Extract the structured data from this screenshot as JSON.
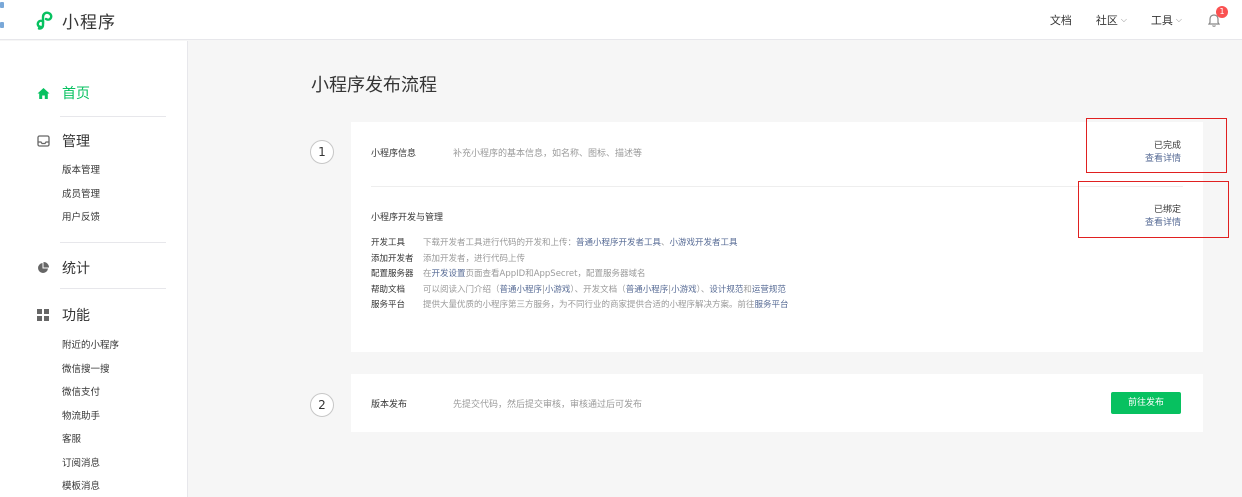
{
  "header": {
    "logo_text": "小程序",
    "nav": [
      {
        "label": "文档",
        "dropdown": false
      },
      {
        "label": "社区",
        "dropdown": true
      },
      {
        "label": "工具",
        "dropdown": true
      }
    ],
    "notification_count": "1",
    "accent_color": "#07c160",
    "link_color": "#576b95"
  },
  "sidebar": {
    "home": {
      "label": "首页",
      "icon": "home-icon"
    },
    "manage": {
      "label": "管理",
      "icon": "inbox-icon",
      "items": [
        "版本管理",
        "成员管理",
        "用户反馈"
      ]
    },
    "stats": {
      "label": "统计",
      "icon": "pie-chart-icon"
    },
    "features": {
      "label": "功能",
      "icon": "grid-icon",
      "items": [
        "附近的小程序",
        "微信搜一搜",
        "微信支付",
        "物流助手",
        "客服",
        "订阅消息",
        "模板消息"
      ]
    }
  },
  "main": {
    "title": "小程序发布流程",
    "step1": {
      "number": "1",
      "info": {
        "title": "小程序信息",
        "desc": "补充小程序的基本信息，如名称、图标、描述等",
        "status": "已完成",
        "link": "查看详情"
      },
      "dev": {
        "title": "小程序开发与管理",
        "status": "已绑定",
        "link": "查看详情",
        "rows": [
          {
            "label": "开发工具",
            "t1": "下载开发者工具进行代码的开发和上传：",
            "l1": "普通小程序开发者工具",
            "t2": "、",
            "l2": "小游戏开发者工具"
          },
          {
            "label": "添加开发者",
            "t1": "添加开发者，进行代码上传"
          },
          {
            "label": "配置服务器",
            "t1": "在",
            "l1": "开发设置",
            "t2": "页面查看AppID和AppSecret，配置服务器域名"
          },
          {
            "label": "帮助文档",
            "t1": "可以阅读入门介绍（",
            "l1": "普通小程序",
            "t2": "|",
            "l2": "小游戏",
            "t3": "）、开发文档（",
            "l3": "普通小程序",
            "t4": "|",
            "l4": "小游戏",
            "t5": "）、",
            "l5": "设计规范",
            "t6": "和",
            "l6": "运营规范"
          },
          {
            "label": "服务平台",
            "t1": "提供大量优质的小程序第三方服务，为不同行业的商家提供合适的小程序解决方案。前往",
            "l1": "服务平台"
          }
        ]
      }
    },
    "step2": {
      "number": "2",
      "title": "版本发布",
      "desc": "先提交代码，然后提交审核，审核通过后可发布",
      "button": "前往发布"
    }
  }
}
